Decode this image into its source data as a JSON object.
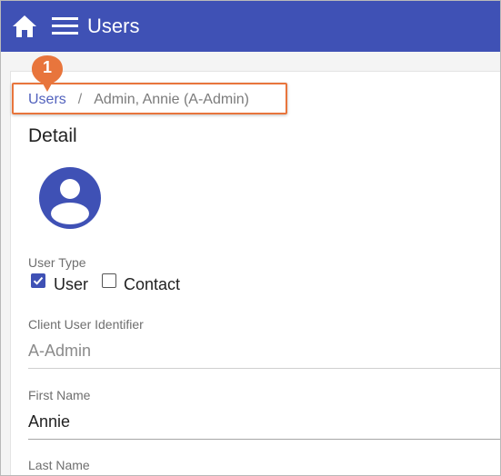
{
  "appbar": {
    "title": "Users",
    "color": "#3f51b5"
  },
  "breadcrumb": {
    "parent": "Users",
    "separator": "/",
    "current": "Admin, Annie (A-Admin)"
  },
  "callout": {
    "number": "1",
    "color": "#e8753c"
  },
  "detail": {
    "title": "Detail",
    "user_type": {
      "label": "User Type",
      "options": [
        {
          "label": "User",
          "checked": true
        },
        {
          "label": "Contact",
          "checked": false
        }
      ]
    },
    "fields": [
      {
        "label": "Client User Identifier",
        "value": "A-Admin"
      },
      {
        "label": "First Name",
        "value": "Annie"
      },
      {
        "label": "Last Name",
        "value": ""
      }
    ]
  }
}
